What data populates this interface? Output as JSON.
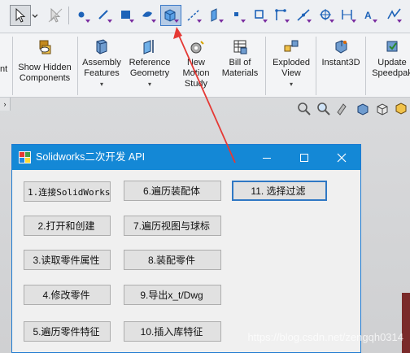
{
  "filter_toolbar": {
    "buttons": [
      "select-icon",
      "select-dropdown-icon",
      "selection-filter-icon",
      "filter-vertex-icon",
      "filter-edge-icon",
      "filter-face-icon",
      "filter-surface-body-icon",
      "filter-solid-body-icon",
      "filter-axis-icon",
      "filter-plane-icon",
      "filter-point-icon",
      "filter-sketch-icon",
      "filter-sketch-segment-icon",
      "filter-midpoint-icon",
      "filter-center-mark-icon",
      "filter-dimension-icon",
      "filter-note-icon"
    ]
  },
  "ribbon": {
    "items": [
      {
        "label": "nt",
        "icon": "component-icon"
      },
      {
        "label": "Show Hidden Components",
        "icon": "show-hidden-icon"
      },
      {
        "label": "Assembly Features",
        "icon": "assembly-features-icon"
      },
      {
        "label": "Reference Geometry",
        "icon": "reference-geometry-icon"
      },
      {
        "label": "New Motion Study",
        "icon": "motion-study-icon"
      },
      {
        "label": "Bill of Materials",
        "icon": "bom-icon"
      },
      {
        "label": "Exploded View",
        "icon": "exploded-view-icon"
      },
      {
        "label": "Instant3D",
        "icon": "instant3d-icon"
      },
      {
        "label": "Update Speedpak",
        "icon": "speedpak-icon"
      }
    ]
  },
  "window": {
    "title": "Solidworks二次开发 API",
    "buttons_col1": [
      "1.连接SolidWorks",
      "2.打开和创建",
      "3.读取零件属性",
      "4.修改零件",
      "5.遍历零件特征"
    ],
    "buttons_col2": [
      "6.遍历装配体",
      "7.遍历视图与球标",
      "8.装配零件",
      "9.导出x_t/Dwg",
      "10.插入库特征"
    ],
    "button_col3": "11. 选择过滤"
  },
  "watermark": "https://blog.csdn.net/zengqh0314",
  "colors": {
    "titlebar": "#1488d6",
    "highlight": "#e53935"
  }
}
